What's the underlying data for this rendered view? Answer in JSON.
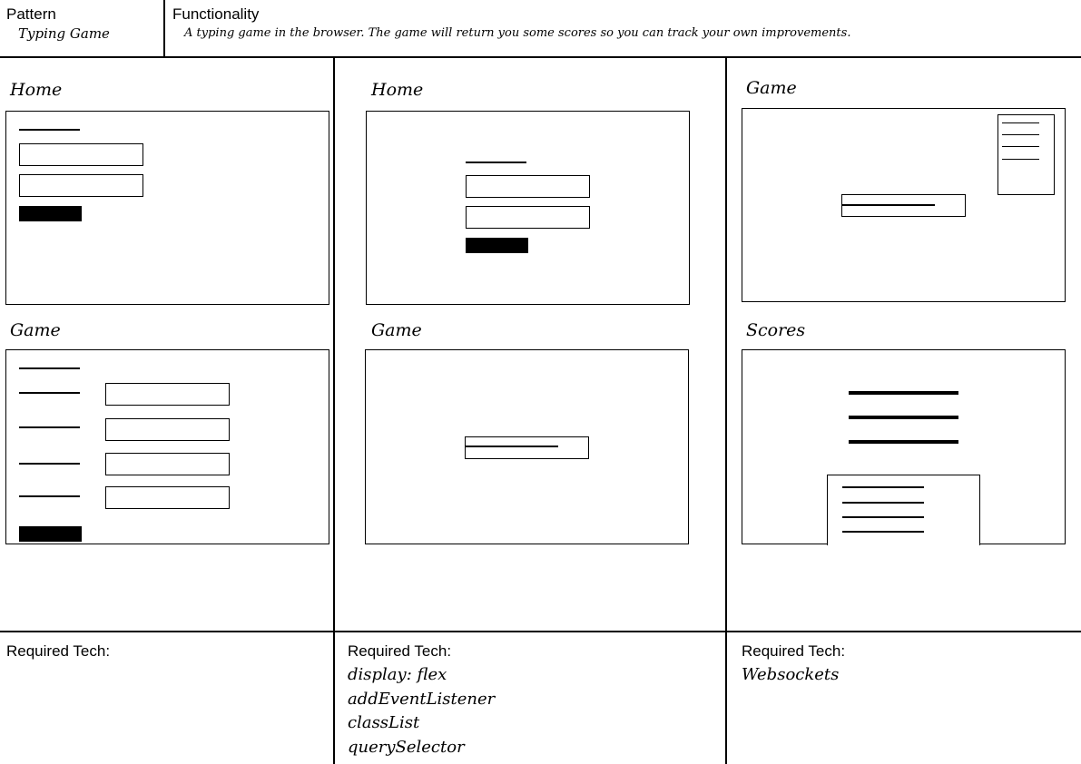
{
  "header": {
    "pattern_label": "Pattern",
    "pattern_value": "Typing Game",
    "functionality_label": "Functionality",
    "functionality_value": "A typing game in the browser. The game will return you some scores so you can track your own improvements."
  },
  "columns": [
    {
      "top_frame_title": "Home",
      "bottom_frame_title": "Game",
      "required_tech_label": "Required Tech:",
      "tech": []
    },
    {
      "top_frame_title": "Home",
      "bottom_frame_title": "Game",
      "required_tech_label": "Required Tech:",
      "tech": [
        "display: flex",
        "addEventListener",
        "classList",
        "querySelector"
      ]
    },
    {
      "top_frame_title": "Game",
      "bottom_frame_title": "Scores",
      "required_tech_label": "Required Tech:",
      "tech": [
        "Websockets"
      ]
    }
  ]
}
